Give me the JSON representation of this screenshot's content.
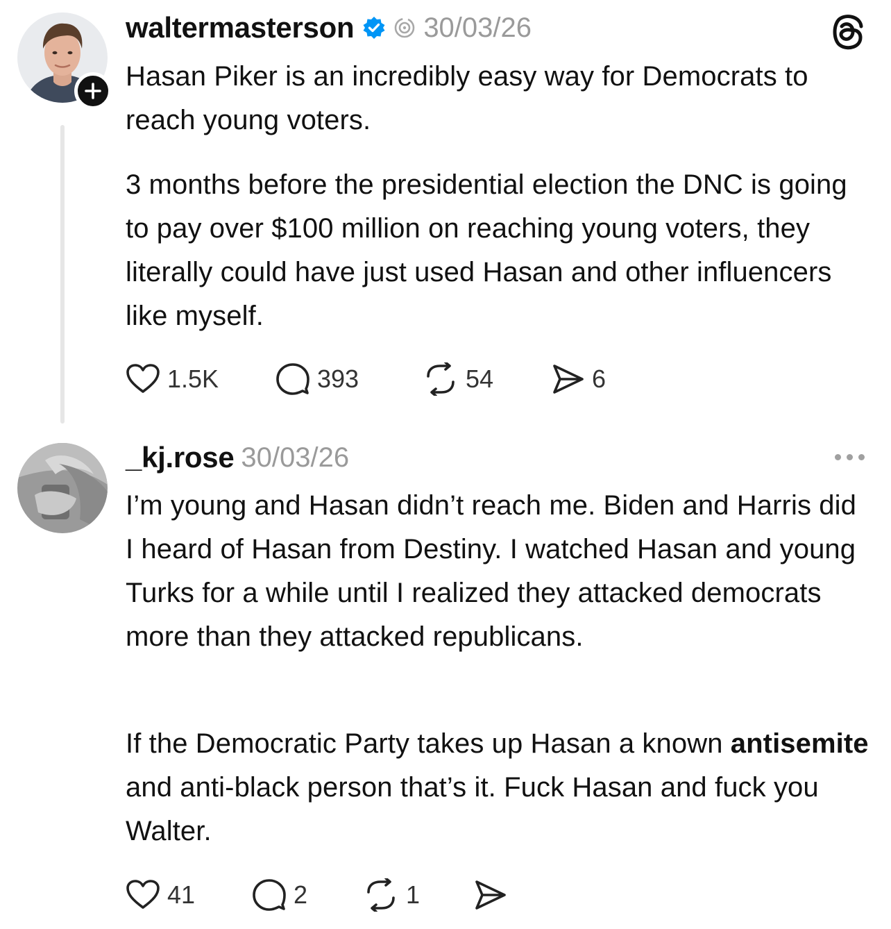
{
  "post": {
    "username": "waltermasterson",
    "date": "30/03/26",
    "paragraphs": [
      "Hasan Piker is an incredibly easy way for Democrats to reach young voters.",
      "3 months before the presidential election the DNC is going to pay over $100 million on reaching young voters, they literally could have just used Hasan and other influencers like myself."
    ],
    "actions": {
      "likes": "1.5K",
      "replies": "393",
      "reposts": "54",
      "shares": "6"
    },
    "icons": [
      "verified-badge-icon",
      "activity-icon",
      "threads-logo-icon",
      "plus-icon"
    ]
  },
  "reply": {
    "username": "_kj.rose",
    "date": "30/03/26",
    "paragraph1": "I’m young and Hasan didn’t reach me. Biden and Harris did I heard of Hasan from Destiny. I watched Hasan and young Turks for a while until I realized they attacked democrats more than they attacked republicans.",
    "paragraph2": {
      "before": "If the Democratic Party takes up Hasan a known ",
      "bold": "antisemite",
      "after": " and anti-black person that’s it. Fuck Hasan and fuck you Walter."
    },
    "actions": {
      "likes": "41",
      "replies": "2",
      "reposts": "1"
    },
    "icons": [
      "more-options-icon"
    ]
  },
  "colors": {
    "verified": "#0095F6",
    "muted_text": "#9A9A9A",
    "thread_line": "#E6E6E6"
  }
}
